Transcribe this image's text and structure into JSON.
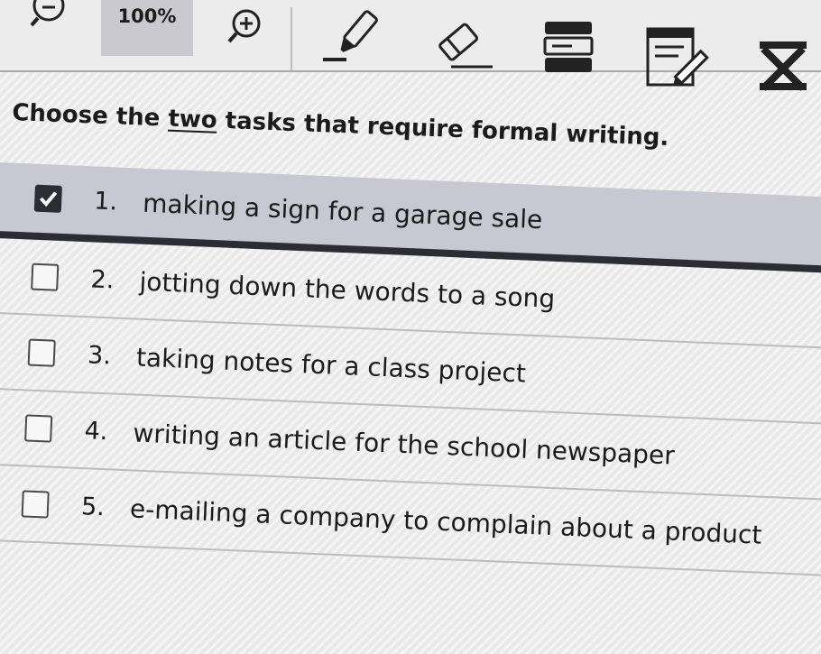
{
  "toolbar": {
    "zoom_out_icon": "zoom-out-icon",
    "zoom_level": "100%",
    "zoom_in_icon": "zoom-in-icon",
    "highlighter_icon": "highlighter-icon",
    "eraser_icon": "eraser-icon",
    "line_reader_icon": "line-reader-icon",
    "notepad_icon": "notepad-icon",
    "eliminate_icon": "answer-eliminator-icon"
  },
  "question": {
    "before": "Choose the ",
    "emphasis": "two",
    "after": " tasks that require formal writing."
  },
  "options": [
    {
      "number": "1.",
      "text": "making a sign for a garage sale",
      "checked": true
    },
    {
      "number": "2.",
      "text": "jotting down the words to a song",
      "checked": false
    },
    {
      "number": "3.",
      "text": "taking notes for a class project",
      "checked": false
    },
    {
      "number": "4.",
      "text": "writing an article for the school newspaper",
      "checked": false
    },
    {
      "number": "5.",
      "text": "e-mailing a company to complain about a product",
      "checked": false
    }
  ],
  "colors": {
    "selected_row": "#c8c8d2",
    "selected_border": "#2b2c34",
    "toolbar_bg": "#ececec",
    "zoom_chip": "#c9c9cf"
  }
}
